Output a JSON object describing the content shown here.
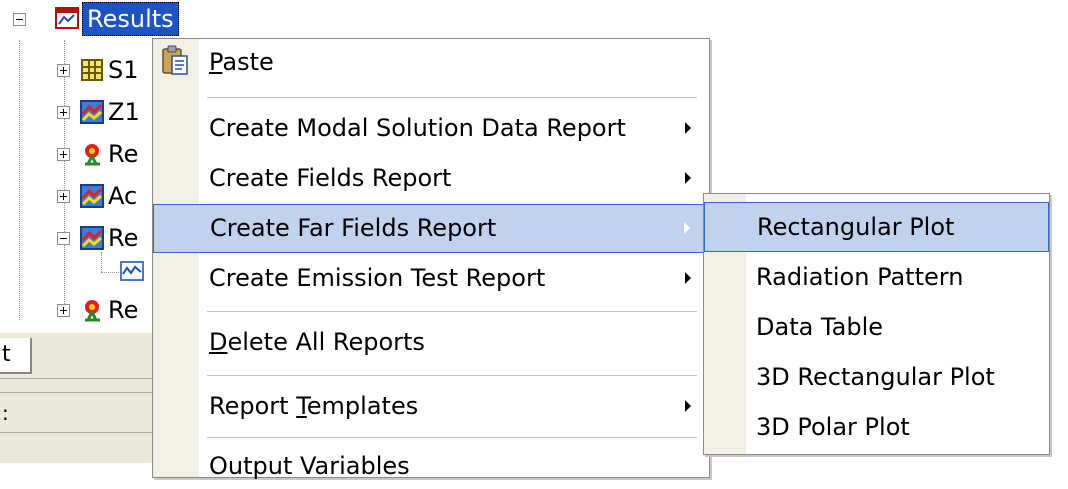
{
  "tree": {
    "results_label": "Results",
    "nodes": [
      {
        "label": "S1",
        "icon": "table-icon",
        "expander": "plus"
      },
      {
        "label": "Z1",
        "icon": "chart-icon",
        "expander": "plus"
      },
      {
        "label": "Re",
        "icon": "radiation-icon",
        "expander": "plus"
      },
      {
        "label": "Ac",
        "icon": "chart-icon",
        "expander": "plus"
      },
      {
        "label": "Re",
        "icon": "chart-icon",
        "expander": "minus"
      },
      {
        "label": "",
        "icon": "plot-icon",
        "expander": "none"
      },
      {
        "label": "Re",
        "icon": "radiation-icon",
        "expander": "plus"
      }
    ],
    "tab_label": "t",
    "lower_text": ":"
  },
  "menu": {
    "paste": {
      "mnemonic": "P",
      "rest": "aste"
    },
    "create_modal": "Create Modal Solution Data Report",
    "create_fields": "Create Fields Report",
    "create_far_fields": "Create Far Fields Report",
    "create_emission": "Create Emission Test Report",
    "delete_all": {
      "mnemonic": "D",
      "rest": "elete All Reports"
    },
    "report_templates": {
      "before": "Report ",
      "mnemonic": "T",
      "after": "emplates"
    },
    "output_variables": "Output Variables"
  },
  "submenu": {
    "items": [
      "Rectangular Plot",
      "Radiation Pattern",
      "Data Table",
      "3D Rectangular Plot",
      "3D Polar Plot"
    ]
  },
  "colors": {
    "selection_blue": "#1c54c8",
    "menu_highlight": "#c1d2ee",
    "menu_highlight_border": "#316ac5",
    "gutter": "#f2efe4"
  }
}
